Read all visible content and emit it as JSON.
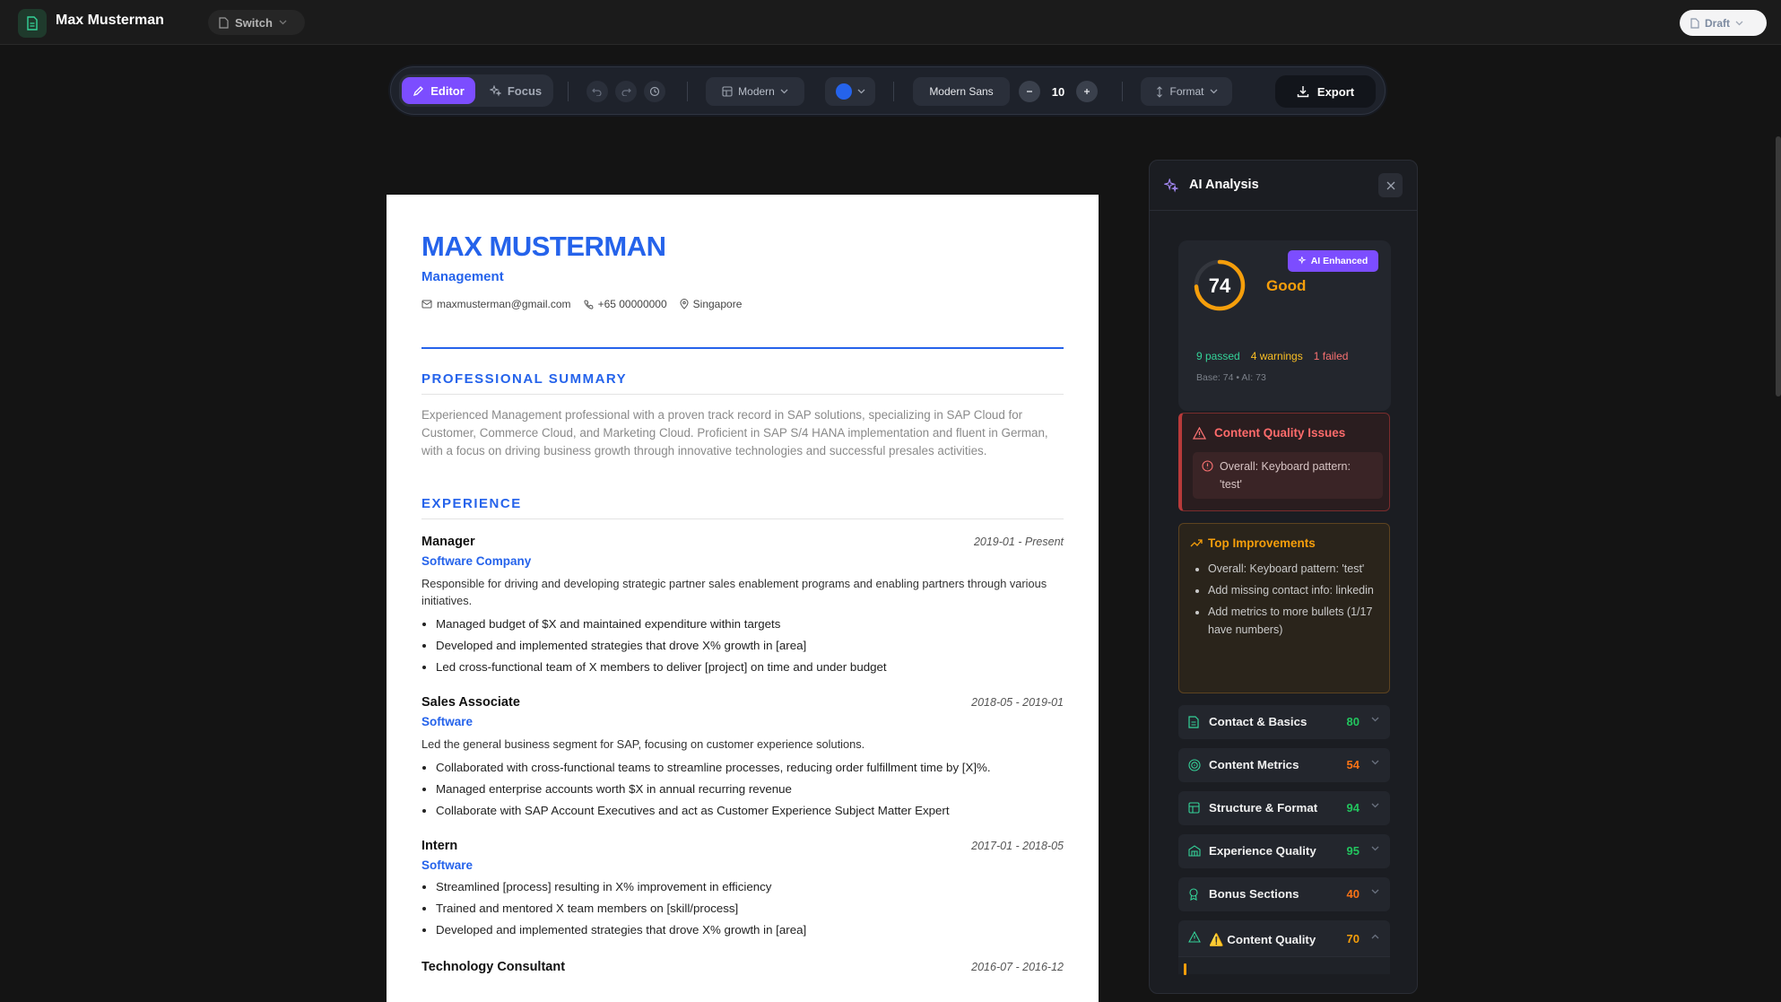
{
  "app": {
    "title": "Max Musterman",
    "switch_label": "Switch",
    "draft_label": "Draft"
  },
  "toolbar": {
    "editor_label": "Editor",
    "focus_label": "Focus",
    "template_label": "Modern",
    "accent_color": "#2563eb",
    "font_label": "Modern Sans",
    "font_size": "10",
    "format_label": "Format",
    "export_label": "Export"
  },
  "resume": {
    "name": "MAX MUSTERMAN",
    "role": "Management",
    "email": "maxmusterman@gmail.com",
    "phone": "+65 00000000",
    "location": "Singapore",
    "summary_heading": "PROFESSIONAL SUMMARY",
    "summary": "Experienced Management professional with a proven track record in SAP solutions, specializing in SAP Cloud for Customer, Commerce Cloud, and Marketing Cloud. Proficient in SAP S/4 HANA implementation and fluent in German, with a focus on driving business growth through innovative technologies and successful presales activities.",
    "experience_heading": "EXPERIENCE",
    "jobs": [
      {
        "title": "Manager",
        "dates": "2019-01 - Present",
        "company": "Software Company",
        "desc": "Responsible for driving and developing strategic partner sales enablement programs and enabling partners through various initiatives.",
        "bullets": [
          "Managed budget of $X and maintained expenditure within targets",
          "Developed and implemented strategies that drove X% growth in [area]",
          "Led cross-functional team of X members to deliver [project] on time and under budget"
        ]
      },
      {
        "title": "Sales Associate",
        "dates": "2018-05 - 2019-01",
        "company": "Software",
        "desc": "Led the general business segment for SAP, focusing on customer experience solutions.",
        "bullets": [
          "Collaborated with cross-functional teams to streamline processes, reducing order fulfillment time by [X]%.",
          "Managed enterprise accounts worth $X in annual recurring revenue",
          "Collaborate with SAP Account Executives and act as Customer Experience Subject Matter Expert"
        ]
      },
      {
        "title": "Intern",
        "dates": "2017-01 - 2018-05",
        "company": "Software",
        "desc": "",
        "bullets": [
          "Streamlined [process] resulting in X% improvement in efficiency",
          "Trained and mentored X team members on [skill/process]",
          "Developed and implemented strategies that drove X% growth in [area]"
        ]
      },
      {
        "title": "Technology Consultant",
        "dates": "2016-07 - 2016-12",
        "company": "",
        "desc": "",
        "bullets": []
      }
    ]
  },
  "ai": {
    "title": "AI Analysis",
    "score": "74",
    "score_fraction": 0.74,
    "rating": "Good",
    "badge": "AI Enhanced",
    "passed": "9 passed",
    "warnings": "4 warnings",
    "failed": "1 failed",
    "base_line": "Base: 74 • AI: 73",
    "issues_title": "Content Quality Issues",
    "issue_text": "Overall: Keyboard pattern: 'test'",
    "improvements_title": "Top Improvements",
    "improvements": [
      "Overall: Keyboard pattern: 'test'",
      "Add missing contact info: linkedin",
      "Add metrics to more bullets (1/17 have numbers)"
    ],
    "categories": [
      {
        "label": "Contact & Basics",
        "score": "80",
        "color": "#22c55e",
        "icon": "document-icon"
      },
      {
        "label": "Content Metrics",
        "score": "54",
        "color": "#f97316",
        "icon": "target-icon"
      },
      {
        "label": "Structure & Format",
        "score": "94",
        "color": "#22c55e",
        "icon": "layout-icon"
      },
      {
        "label": "Experience Quality",
        "score": "95",
        "color": "#22c55e",
        "icon": "building-icon"
      },
      {
        "label": "Bonus Sections",
        "score": "40",
        "color": "#f97316",
        "icon": "award-icon"
      },
      {
        "label": "⚠️ Content Quality",
        "score": "70",
        "color": "#f59e0b",
        "icon": "warning-icon"
      }
    ]
  }
}
